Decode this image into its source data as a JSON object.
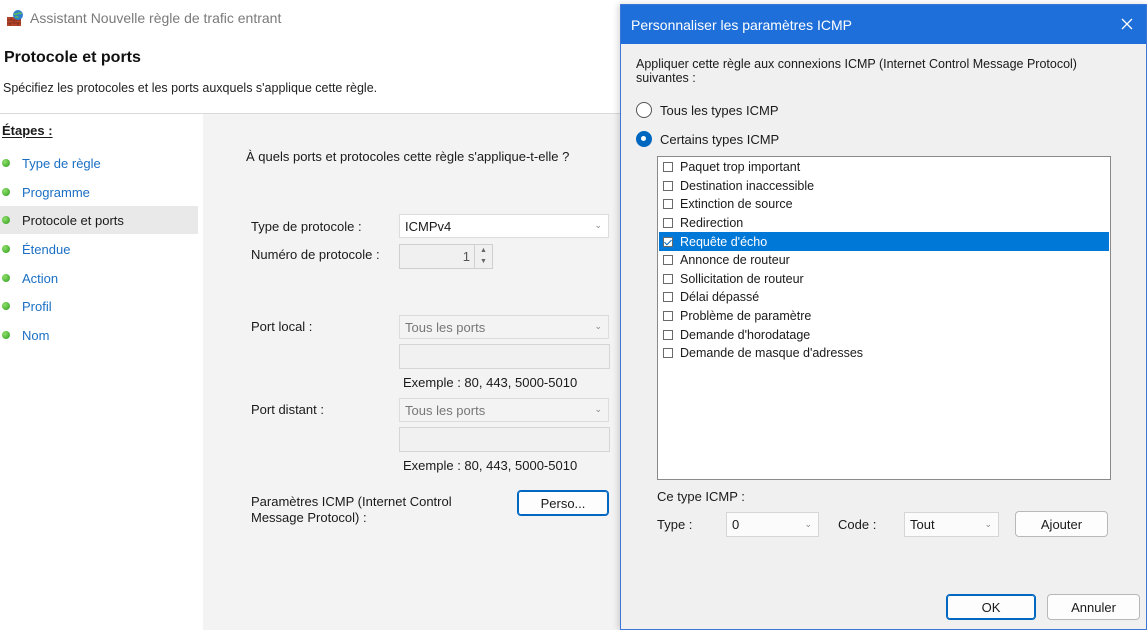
{
  "wizard": {
    "title": "Assistant Nouvelle règle de trafic entrant",
    "heading": "Protocole et ports",
    "subheading": "Spécifiez les protocoles et les ports auxquels s'applique cette règle.",
    "steps_title": "Étapes :",
    "steps": [
      {
        "label": "Type de règle",
        "active": false
      },
      {
        "label": "Programme",
        "active": false
      },
      {
        "label": "Protocole et ports",
        "active": true
      },
      {
        "label": "Étendue",
        "active": false
      },
      {
        "label": "Action",
        "active": false
      },
      {
        "label": "Profil",
        "active": false
      },
      {
        "label": "Nom",
        "active": false
      }
    ],
    "question": "À quels ports et protocoles cette règle s'applique-t-elle ?",
    "protocol_type_label": "Type de protocole :",
    "protocol_type_value": "ICMPv4",
    "protocol_number_label": "Numéro de protocole :",
    "protocol_number_value": "1",
    "local_port_label": "Port local :",
    "local_port_value": "Tous les ports",
    "local_port_example": "Exemple : 80, 443, 5000-5010",
    "remote_port_label": "Port distant :",
    "remote_port_value": "Tous les ports",
    "remote_port_example": "Exemple : 80, 443, 5000-5010",
    "icmp_label_line1": "Paramètres ICMP (Internet Control",
    "icmp_label_line2": "Message Protocol) :",
    "custom_button": "Perso..."
  },
  "dialog": {
    "title": "Personnaliser les paramètres ICMP",
    "intro_line1": "Appliquer cette règle aux connexions ICMP (Internet Control Message Protocol)",
    "intro_line2": "suivantes :",
    "radio_all": "Tous les types ICMP",
    "radio_specific": "Certains types ICMP",
    "selected_radio": "specific",
    "icmp_types": [
      {
        "label": "Paquet trop important",
        "checked": false,
        "selected": false
      },
      {
        "label": "Destination inaccessible",
        "checked": false,
        "selected": false
      },
      {
        "label": "Extinction de source",
        "checked": false,
        "selected": false
      },
      {
        "label": "Redirection",
        "checked": false,
        "selected": false
      },
      {
        "label": "Requête d'écho",
        "checked": true,
        "selected": true
      },
      {
        "label": "Annonce de routeur",
        "checked": false,
        "selected": false
      },
      {
        "label": "Sollicitation de routeur",
        "checked": false,
        "selected": false
      },
      {
        "label": "Délai dépassé",
        "checked": false,
        "selected": false
      },
      {
        "label": "Problème de paramètre",
        "checked": false,
        "selected": false
      },
      {
        "label": "Demande d'horodatage",
        "checked": false,
        "selected": false
      },
      {
        "label": "Demande de masque d'adresses",
        "checked": false,
        "selected": false
      }
    ],
    "this_type_label": "Ce type ICMP :",
    "type_label": "Type :",
    "type_value": "0",
    "code_label": "Code :",
    "code_value": "Tout",
    "add_button": "Ajouter",
    "ok_button": "OK",
    "cancel_button": "Annuler"
  },
  "colors": {
    "accent": "#0067c0",
    "dialog_titlebar": "#1e6fd9",
    "selection": "#0078d7",
    "link": "#1a6fc4"
  }
}
